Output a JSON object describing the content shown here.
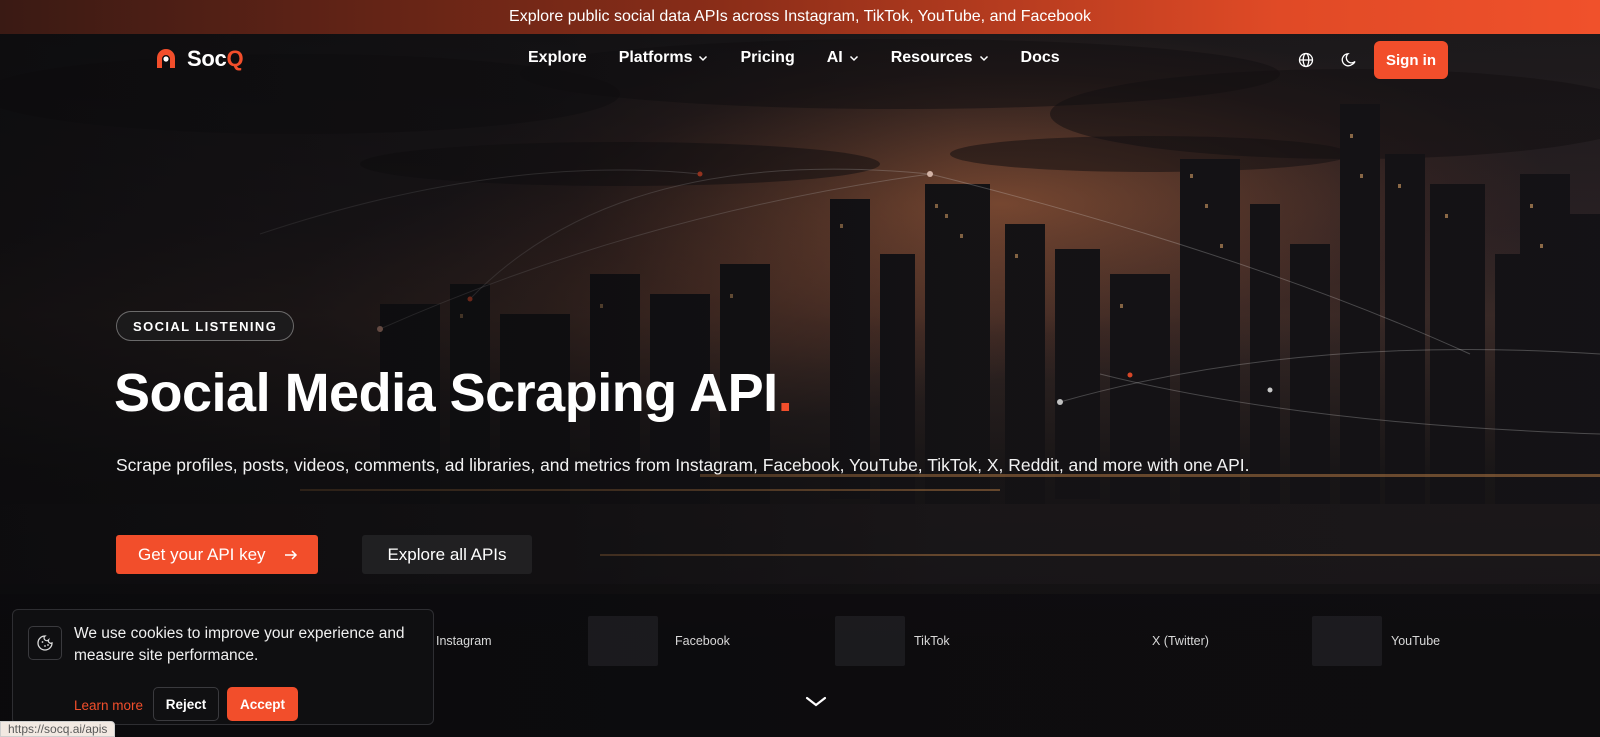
{
  "announcement": {
    "text": "Explore public social data APIs across Instagram, TikTok, YouTube, and Facebook"
  },
  "brand": {
    "name_main": "Soc",
    "name_accent": "Q",
    "accent_color": "#f24e2b"
  },
  "nav": {
    "items": [
      {
        "label": "Explore",
        "dropdown": false
      },
      {
        "label": "Platforms",
        "dropdown": true
      },
      {
        "label": "Pricing",
        "dropdown": false
      },
      {
        "label": "AI",
        "dropdown": true
      },
      {
        "label": "Resources",
        "dropdown": true
      },
      {
        "label": "Docs",
        "dropdown": false
      }
    ],
    "signin_label": "Sign in"
  },
  "hero": {
    "badge": "SOCIAL LISTENING",
    "title": "Social Media Scraping API",
    "title_dot": ".",
    "subtitle": "Scrape profiles, posts, videos, comments, ad libraries, and metrics from Instagram, Facebook, YouTube, TikTok, X, Reddit, and more with one API.",
    "primary_cta": "Get your API key",
    "secondary_cta": "Explore all APIs"
  },
  "platforms": [
    "Instagram",
    "Facebook",
    "TikTok",
    "X (Twitter)",
    "YouTube"
  ],
  "cookie": {
    "text": "We use cookies to improve your experience and measure site performance.",
    "learn_more": "Learn more",
    "reject": "Reject",
    "accept": "Accept"
  },
  "status_url": "https://socq.ai/apis"
}
